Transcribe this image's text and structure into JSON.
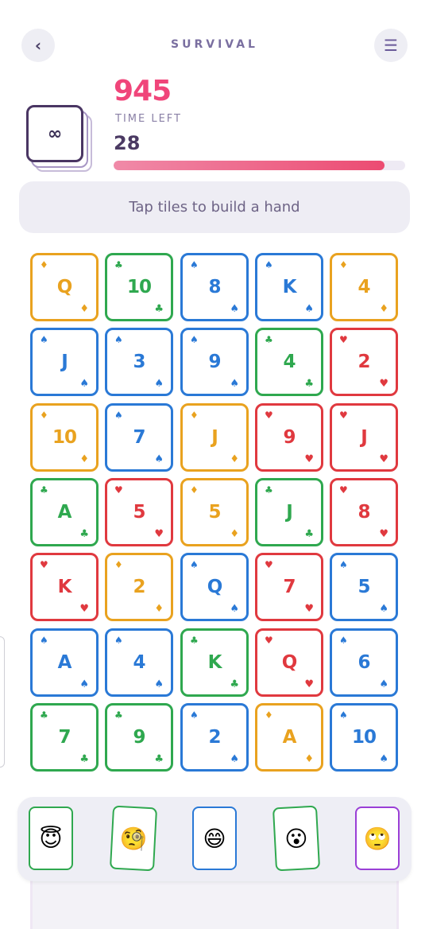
{
  "header": {
    "title": "SURVIVAL",
    "back_icon": "‹",
    "menu_icon": "☰"
  },
  "deck": {
    "label": "∞"
  },
  "score": "945",
  "time_label": "TIME LEFT",
  "time_value": "28",
  "time_progress": 0.93,
  "hint": "Tap tiles to build a hand",
  "colors": {
    "diamonds": "#e9a21f",
    "clubs": "#2fa84f",
    "spades": "#2a79d6",
    "hearts": "#e0393f"
  },
  "suits": {
    "diamonds": "♦",
    "clubs": "♣",
    "spades": "♠",
    "hearts": "♥"
  },
  "grid": [
    [
      {
        "rank": "Q",
        "suit": "diamonds"
      },
      {
        "rank": "10",
        "suit": "clubs"
      },
      {
        "rank": "8",
        "suit": "spades"
      },
      {
        "rank": "K",
        "suit": "spades"
      },
      {
        "rank": "4",
        "suit": "diamonds"
      }
    ],
    [
      {
        "rank": "J",
        "suit": "spades"
      },
      {
        "rank": "3",
        "suit": "spades"
      },
      {
        "rank": "9",
        "suit": "spades"
      },
      {
        "rank": "4",
        "suit": "clubs"
      },
      {
        "rank": "2",
        "suit": "hearts"
      }
    ],
    [
      {
        "rank": "10",
        "suit": "diamonds"
      },
      {
        "rank": "7",
        "suit": "spades"
      },
      {
        "rank": "J",
        "suit": "diamonds"
      },
      {
        "rank": "9",
        "suit": "hearts"
      },
      {
        "rank": "J",
        "suit": "hearts"
      }
    ],
    [
      {
        "rank": "A",
        "suit": "clubs"
      },
      {
        "rank": "5",
        "suit": "hearts"
      },
      {
        "rank": "5",
        "suit": "diamonds"
      },
      {
        "rank": "J",
        "suit": "clubs"
      },
      {
        "rank": "8",
        "suit": "hearts"
      }
    ],
    [
      {
        "rank": "K",
        "suit": "hearts"
      },
      {
        "rank": "2",
        "suit": "diamonds"
      },
      {
        "rank": "Q",
        "suit": "spades"
      },
      {
        "rank": "7",
        "suit": "hearts"
      },
      {
        "rank": "5",
        "suit": "spades"
      }
    ],
    [
      {
        "rank": "A",
        "suit": "spades"
      },
      {
        "rank": "4",
        "suit": "spades"
      },
      {
        "rank": "K",
        "suit": "clubs"
      },
      {
        "rank": "Q",
        "suit": "hearts"
      },
      {
        "rank": "6",
        "suit": "spades"
      }
    ],
    [
      {
        "rank": "7",
        "suit": "clubs"
      },
      {
        "rank": "9",
        "suit": "clubs"
      },
      {
        "rank": "2",
        "suit": "spades"
      },
      {
        "rank": "A",
        "suit": "diamonds"
      },
      {
        "rank": "10",
        "suit": "spades"
      }
    ]
  ],
  "jokers": [
    {
      "emoji": "😇",
      "border": "#2fa84f",
      "icon": "joker-halo-icon"
    },
    {
      "emoji": "🧐",
      "border": "#2fa84f",
      "icon": "joker-monocle-icon"
    },
    {
      "emoji": "😄",
      "border": "#2a79d6",
      "icon": "joker-grin-icon"
    },
    {
      "emoji": "😮",
      "border": "#2fa84f",
      "icon": "joker-surprised-icon"
    },
    {
      "emoji": "🙄",
      "border": "#9a3fd6",
      "icon": "joker-eyeroll-icon"
    }
  ]
}
